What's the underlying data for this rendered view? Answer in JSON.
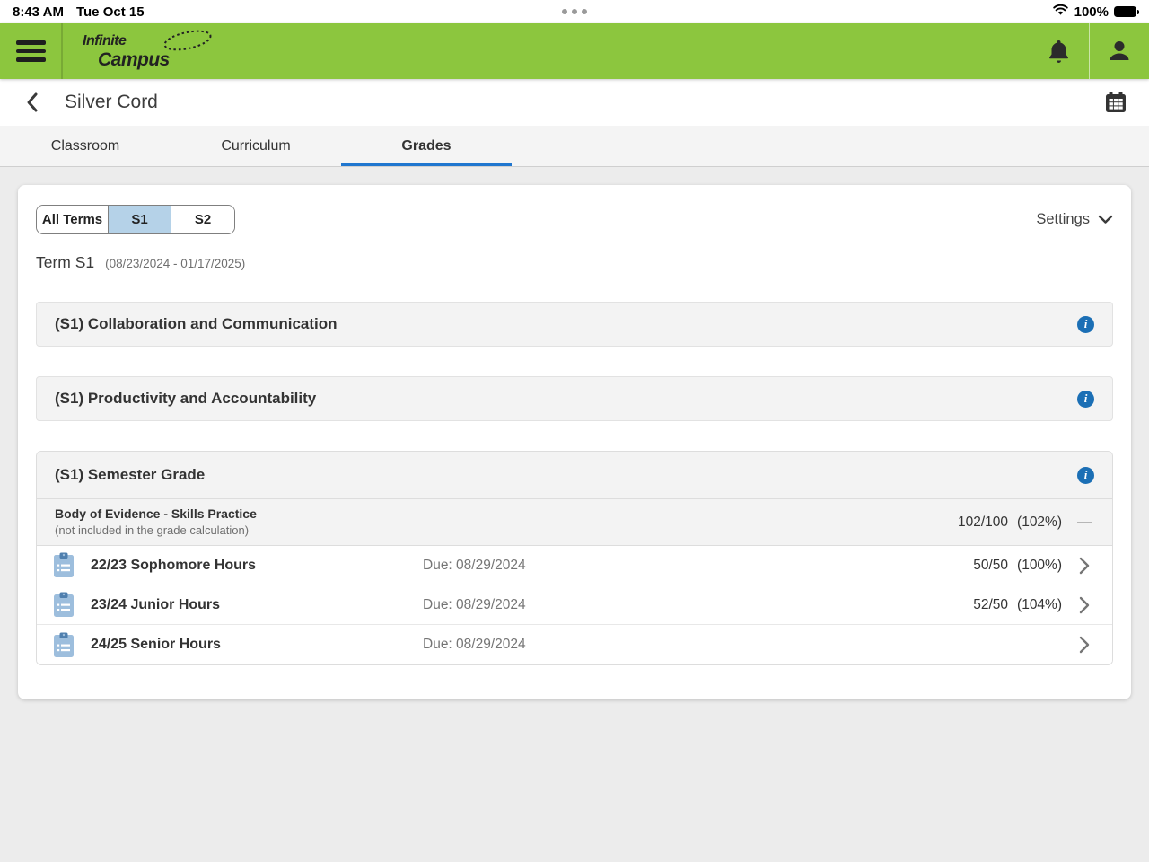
{
  "status_bar": {
    "time": "8:43 AM",
    "date": "Tue Oct 15",
    "battery": "100%"
  },
  "header": {
    "logo_line1": "Infinite",
    "logo_line2": "Campus"
  },
  "title_bar": {
    "title": "Silver Cord"
  },
  "tabs": [
    {
      "label": "Classroom"
    },
    {
      "label": "Curriculum"
    },
    {
      "label": "Grades"
    }
  ],
  "toolbar": {
    "terms": [
      {
        "label": "All Terms"
      },
      {
        "label": "S1"
      },
      {
        "label": "S2"
      }
    ],
    "settings_label": "Settings"
  },
  "term_info": {
    "name": "Term S1",
    "range": "(08/23/2024 - 01/17/2025)"
  },
  "sections": [
    {
      "title": "(S1) Collaboration and Communication"
    },
    {
      "title": "(S1) Productivity and Accountability"
    }
  ],
  "semester_group": {
    "title": "(S1) Semester Grade",
    "info_glyph": "i",
    "category": {
      "name": "Body of Evidence - Skills Practice",
      "note": "(not included in the grade calculation)",
      "score": "102/100",
      "percent": "(102%)",
      "collapse_dash": "—"
    },
    "assignments": [
      {
        "title": "22/23 Sophomore Hours",
        "due": "Due: 08/29/2024",
        "score": "50/50",
        "percent": "(100%)"
      },
      {
        "title": "23/24 Junior Hours",
        "due": "Due: 08/29/2024",
        "score": "52/50",
        "percent": "(104%)"
      },
      {
        "title": "24/25 Senior Hours",
        "due": "Due: 08/29/2024",
        "score": "",
        "percent": ""
      }
    ]
  },
  "colors": {
    "brand_green": "#8cc63e",
    "tab_accent_blue": "#1f76cf",
    "info_blue": "#1b6fb5",
    "selected_term_bg": "#b5d2e8"
  }
}
